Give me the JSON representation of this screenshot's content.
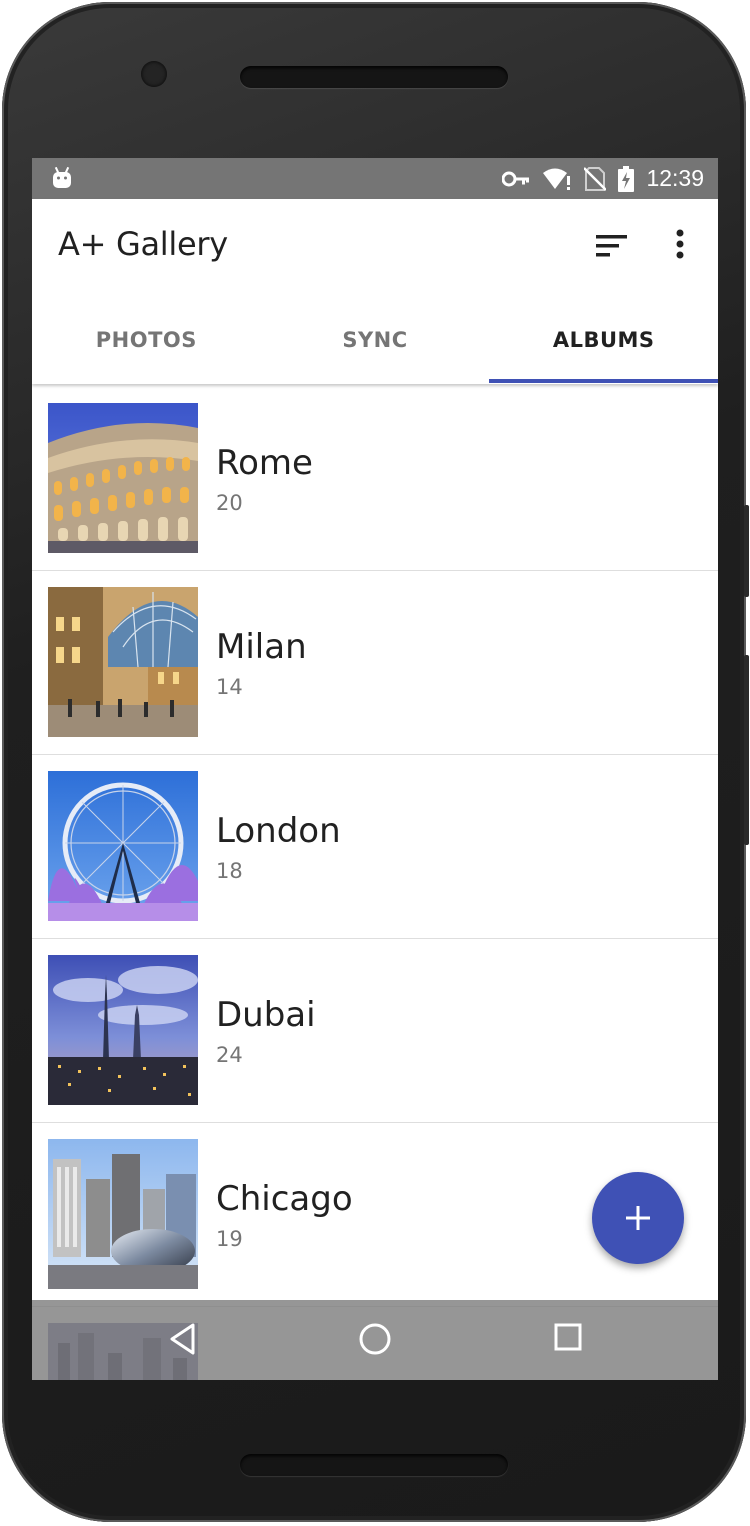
{
  "status_bar": {
    "time": "12:39",
    "icons": [
      "android-debug-icon",
      "vpn-key-icon",
      "wifi-alert-icon",
      "no-sim-icon",
      "battery-charging-icon"
    ]
  },
  "app_bar": {
    "title": "A+ Gallery",
    "actions": [
      "sort-icon",
      "more-vert-icon"
    ]
  },
  "tabs": [
    {
      "label": "PHOTOS",
      "active": false
    },
    {
      "label": "SYNC",
      "active": false
    },
    {
      "label": "ALBUMS",
      "active": true
    }
  ],
  "albums": [
    {
      "name": "Rome",
      "count": "20"
    },
    {
      "name": "Milan",
      "count": "14"
    },
    {
      "name": "London",
      "count": "18"
    },
    {
      "name": "Dubai",
      "count": "24"
    },
    {
      "name": "Chicago",
      "count": "19"
    }
  ],
  "fab": {
    "icon": "add-icon",
    "label": "+"
  },
  "nav_bar": {
    "icons": [
      "back-icon",
      "home-icon",
      "recents-icon"
    ]
  },
  "colors": {
    "accent": "#3f51b5",
    "status_bar": "#757575",
    "title_text": "#212121",
    "secondary_text": "#757575"
  }
}
